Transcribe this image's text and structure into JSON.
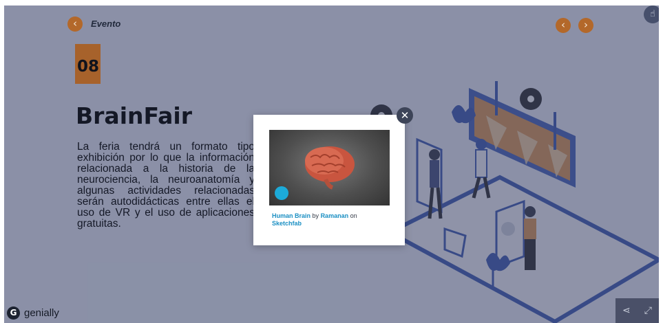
{
  "header": {
    "back_icon": "chevron-left-icon",
    "section_label": "Evento"
  },
  "slide": {
    "number": "08",
    "title": "BrainFair",
    "body": "La feria tendrá un formato tipo exhibición por lo que la información relacionada a la historia de la neurociencia, la neuroanatomía y algunas actividades relacionadas serán autodidácticas entre ellas el uso de VR y el uso de aplicaciones gratuitas."
  },
  "nav": {
    "prev_icon": "chevron-left-icon",
    "next_icon": "chevron-right-icon"
  },
  "modal": {
    "embed_model": "Human Brain",
    "credit_by": "by",
    "credit_author": "Ramanan",
    "credit_on": "on",
    "credit_platform": "Sketchfab",
    "close_icon": "close-icon"
  },
  "brand": {
    "name": "genially"
  },
  "colors": {
    "accent": "#b3682a",
    "overlay": "#5d6585",
    "link": "#1a8fc3"
  }
}
